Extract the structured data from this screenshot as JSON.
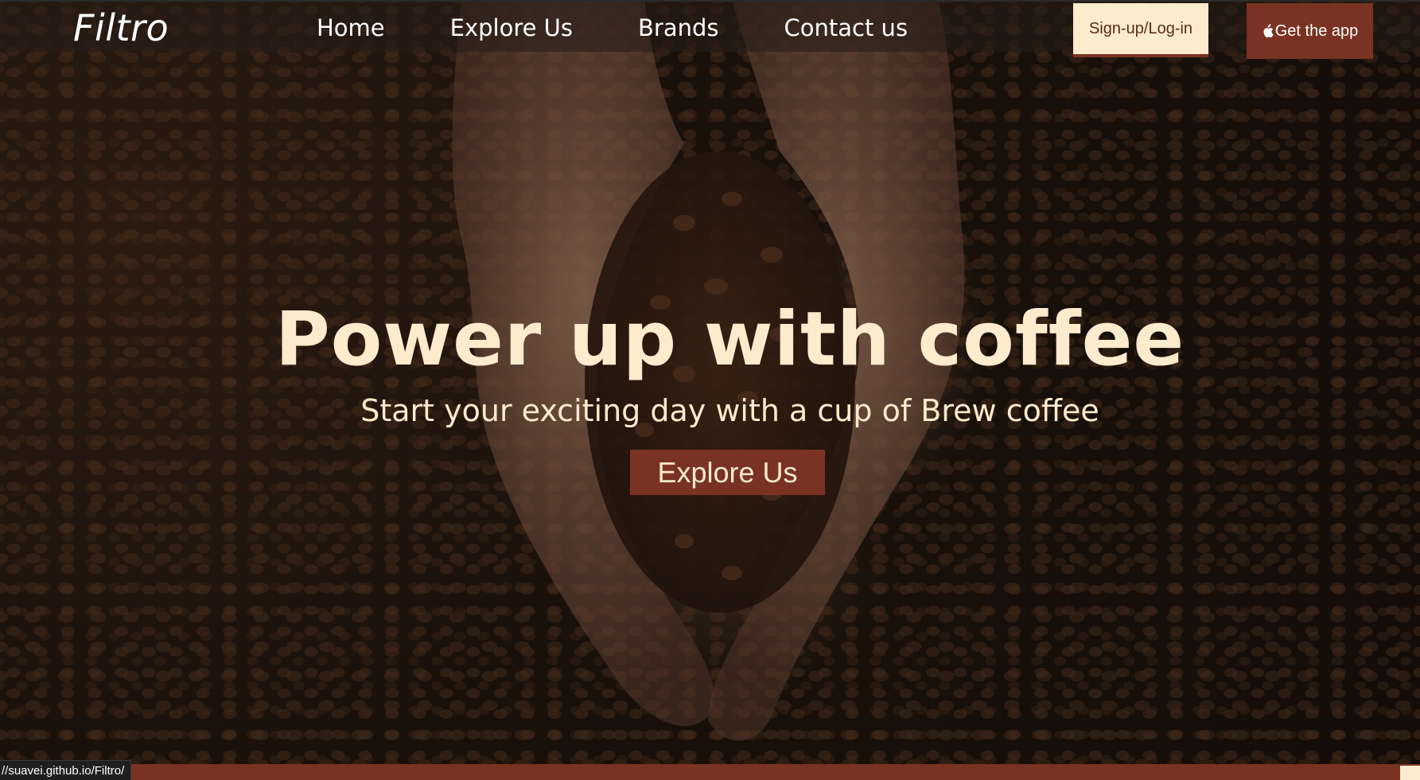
{
  "brand": {
    "logo_text": "Filtro"
  },
  "nav": {
    "items": [
      {
        "label": "Home"
      },
      {
        "label": "Explore Us"
      },
      {
        "label": "Brands"
      },
      {
        "label": "Contact us"
      }
    ],
    "signup_label": "Sign-up/Log-in",
    "app_label": "Get the app",
    "app_icon": "apple-icon"
  },
  "hero": {
    "title": "Power up with coffee",
    "subtitle": "Start your exciting day with a cup of Brew coffee",
    "cta_label": "Explore Us"
  },
  "status_bar": {
    "url": "//suavei.github.io/Filtro/"
  },
  "colors": {
    "accent": "#7a3322",
    "cream": "#fdebcd",
    "background": "#1b120c"
  }
}
